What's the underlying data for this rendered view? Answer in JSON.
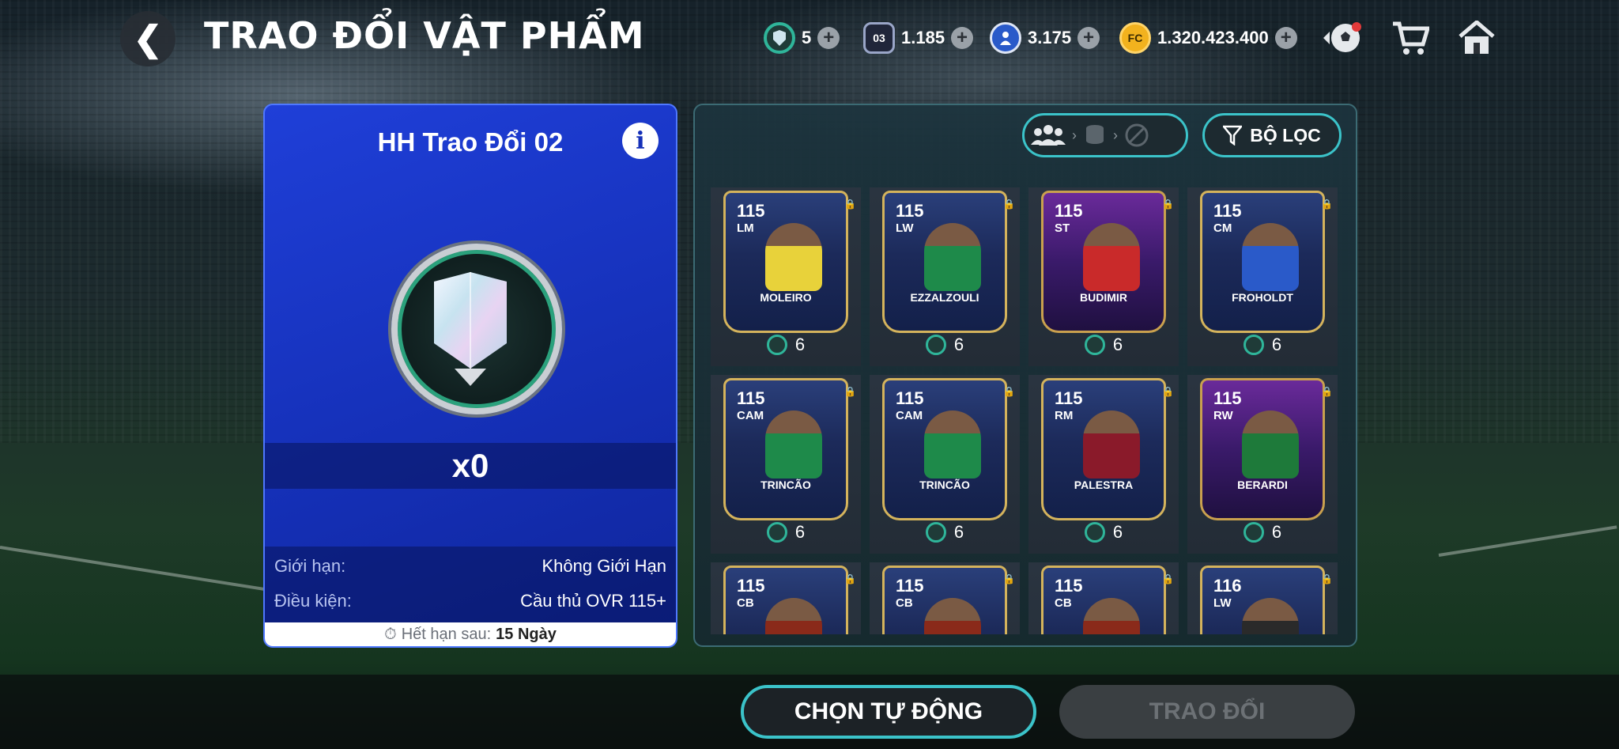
{
  "header": {
    "title": "TRAO ĐỔI VẬT PHẨM",
    "currencies": [
      {
        "icon": "shield-token-icon",
        "value": "5"
      },
      {
        "icon": "chip-03-icon",
        "chip": "03",
        "value": "1.185"
      },
      {
        "icon": "player-coin-icon",
        "value": "3.175"
      },
      {
        "icon": "fc-coin-icon",
        "value": "1.320.423.400"
      }
    ]
  },
  "left_panel": {
    "title": "HH Trao Đổi 02",
    "count": "x0",
    "limit_label": "Giới hạn:",
    "limit_value": "Không Giới Hạn",
    "condition_label": "Điều kiện:",
    "condition_value": "Cầu thủ OVR 115+",
    "expiry_label": "Hết hạn sau:",
    "expiry_value": "15 Ngày"
  },
  "right_panel": {
    "filter_label": "BỘ LỌC",
    "cards": [
      {
        "ovr": "115",
        "pos": "LM",
        "name": "MOLEIRO",
        "cost": "6",
        "style": "gold",
        "kit": "#e8d23a"
      },
      {
        "ovr": "115",
        "pos": "LW",
        "name": "EZZALZOULI",
        "cost": "6",
        "style": "gold",
        "kit": "#1e8a4a"
      },
      {
        "ovr": "115",
        "pos": "ST",
        "name": "BUDIMIR",
        "cost": "6",
        "style": "purple",
        "kit": "#c92a2a"
      },
      {
        "ovr": "115",
        "pos": "CM",
        "name": "FROHOLDT",
        "cost": "6",
        "style": "gold",
        "kit": "#2a5ac9"
      },
      {
        "ovr": "115",
        "pos": "CAM",
        "name": "TRINCÃO",
        "cost": "6",
        "style": "gold",
        "kit": "#1e8a4a"
      },
      {
        "ovr": "115",
        "pos": "CAM",
        "name": "TRINCÃO",
        "cost": "6",
        "style": "gold",
        "kit": "#1e8a4a"
      },
      {
        "ovr": "115",
        "pos": "RM",
        "name": "PALESTRA",
        "cost": "6",
        "style": "gold",
        "kit": "#8a1a2a"
      },
      {
        "ovr": "115",
        "pos": "RW",
        "name": "BERARDI",
        "cost": "6",
        "style": "purple",
        "kit": "#1e7a3a"
      },
      {
        "ovr": "115",
        "pos": "CB",
        "name": "",
        "cost": "",
        "style": "gold",
        "kit": "#8a2a1a"
      },
      {
        "ovr": "115",
        "pos": "CB",
        "name": "",
        "cost": "",
        "style": "gold",
        "kit": "#8a2a1a"
      },
      {
        "ovr": "115",
        "pos": "CB",
        "name": "",
        "cost": "",
        "style": "gold",
        "kit": "#8a2a1a"
      },
      {
        "ovr": "116",
        "pos": "LW",
        "name": "",
        "cost": "",
        "style": "gold",
        "kit": "#2a2a2a"
      }
    ]
  },
  "footer": {
    "auto_select_label": "CHỌN TỰ ĐỘNG",
    "trade_label": "TRAO ĐỔI"
  },
  "colors": {
    "accent_cyan": "#3bc3c9",
    "panel_blue": "#1530b8",
    "gold": "#f2b21e"
  }
}
